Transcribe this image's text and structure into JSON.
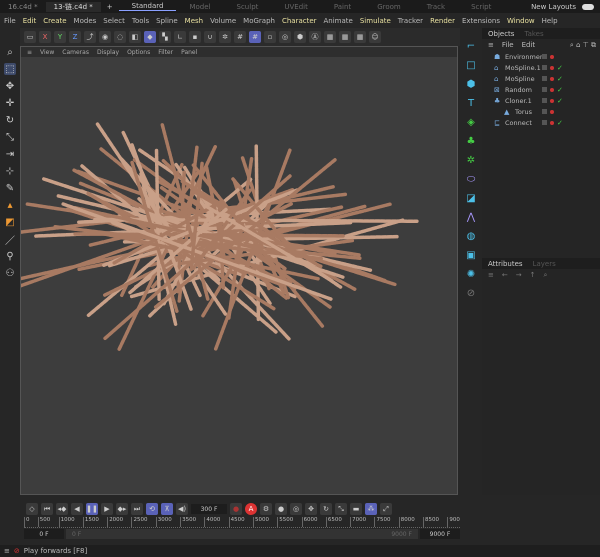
{
  "tabs": {
    "docs": [
      "16.c4d *",
      "13-链.c4d *"
    ],
    "layouts": [
      "Standard",
      "Model",
      "Sculpt",
      "UVEdit",
      "Paint",
      "Groom",
      "Track",
      "Script"
    ],
    "new_layouts": "New Layouts"
  },
  "menu": [
    "File",
    "Edit",
    "Create",
    "Modes",
    "Select",
    "Tools",
    "Spline",
    "Mesh",
    "Volume",
    "MoGraph",
    "Character",
    "Animate",
    "Simulate",
    "Tracker",
    "Render",
    "Extensions",
    "Window",
    "Help"
  ],
  "toolbar": {
    "axes": [
      "X",
      "Y",
      "Z"
    ]
  },
  "viewport_menu": [
    "View",
    "Cameras",
    "Display",
    "Options",
    "Filter",
    "Panel"
  ],
  "objects_panel": {
    "tabs": [
      "Objects",
      "Takes"
    ],
    "menu": [
      "File",
      "Edit"
    ],
    "items": [
      {
        "name": "Environment",
        "icon": "environment-icon",
        "check": false
      },
      {
        "name": "MoSpline.1",
        "icon": "mospline-icon",
        "check": true
      },
      {
        "name": "MoSpline",
        "icon": "mospline-icon",
        "check": true
      },
      {
        "name": "Random",
        "icon": "random-effector-icon",
        "check": true
      },
      {
        "name": "Cloner.1",
        "icon": "cloner-icon",
        "check": true
      },
      {
        "name": "Torus",
        "icon": "torus-icon",
        "check": false
      },
      {
        "name": "Connect",
        "icon": "connect-icon",
        "check": true
      }
    ]
  },
  "attributes_panel": {
    "tabs": [
      "Attributes",
      "Layers"
    ]
  },
  "timeline": {
    "current_frame": "300 F",
    "ruler": [
      "0",
      "500",
      "1000",
      "1500",
      "2000",
      "2500",
      "3000",
      "3500",
      "4000",
      "4500",
      "5000",
      "5500",
      "6000",
      "6500",
      "7000",
      "7500",
      "8000",
      "8500",
      "900"
    ],
    "start": "0 F",
    "range_start": "0 F",
    "range_end": "9000 F",
    "end": "9000 F",
    "accent": "#5a62b8"
  },
  "status": {
    "text": "Play forwards [F8]"
  }
}
